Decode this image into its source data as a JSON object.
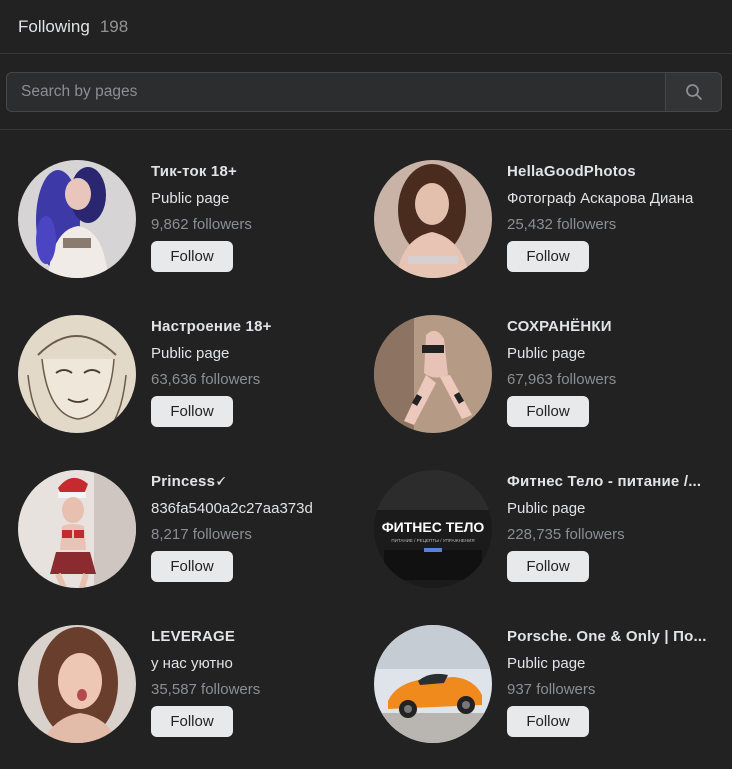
{
  "header": {
    "title": "Following",
    "count": "198"
  },
  "search": {
    "placeholder": "Search by pages",
    "value": ""
  },
  "follow_label": "Follow",
  "pages": [
    {
      "name": "Тик-ток 18+",
      "subtitle": "Public page",
      "followers": "9,862 followers",
      "avatar": "avatar-blue-hair-woman"
    },
    {
      "name": "HellaGoodPhotos",
      "subtitle": "Фотограф Аскарова Диана",
      "followers": "25,432 followers",
      "avatar": "avatar-woman-portrait"
    },
    {
      "name": "Настроение 18+",
      "subtitle": "Public page",
      "followers": "63,636 followers",
      "avatar": "avatar-sketch-drawing"
    },
    {
      "name": "СОХРАНЁНКИ",
      "subtitle": "Public page",
      "followers": "67,963 followers",
      "avatar": "avatar-legs-photo"
    },
    {
      "name": "Princess🗸",
      "subtitle": "836fa5400a2c27aa373d",
      "followers": "8,217 followers",
      "avatar": "avatar-santa-hat-selfie"
    },
    {
      "name": "Фитнес Тело - питание /...",
      "subtitle": "Public page",
      "followers": "228,735 followers",
      "avatar": "avatar-fitness-logo",
      "logo_text": "ФИТНЕС ТЕЛО",
      "logo_subtext": "ПИТАНИЕ / РЕЦЕПТЫ / УПРАЖНЕНИЯ"
    },
    {
      "name": "LEVERAGE",
      "subtitle": "у нас уютно",
      "followers": "35,587 followers",
      "avatar": "avatar-girl-selfie"
    },
    {
      "name": "Porsche. One & Only | По...",
      "subtitle": "Public page",
      "followers": "937 followers",
      "avatar": "avatar-orange-car"
    }
  ],
  "colors": {
    "background": "#222222",
    "button": "#e8e9eb",
    "muted_text": "#8b8e93"
  }
}
